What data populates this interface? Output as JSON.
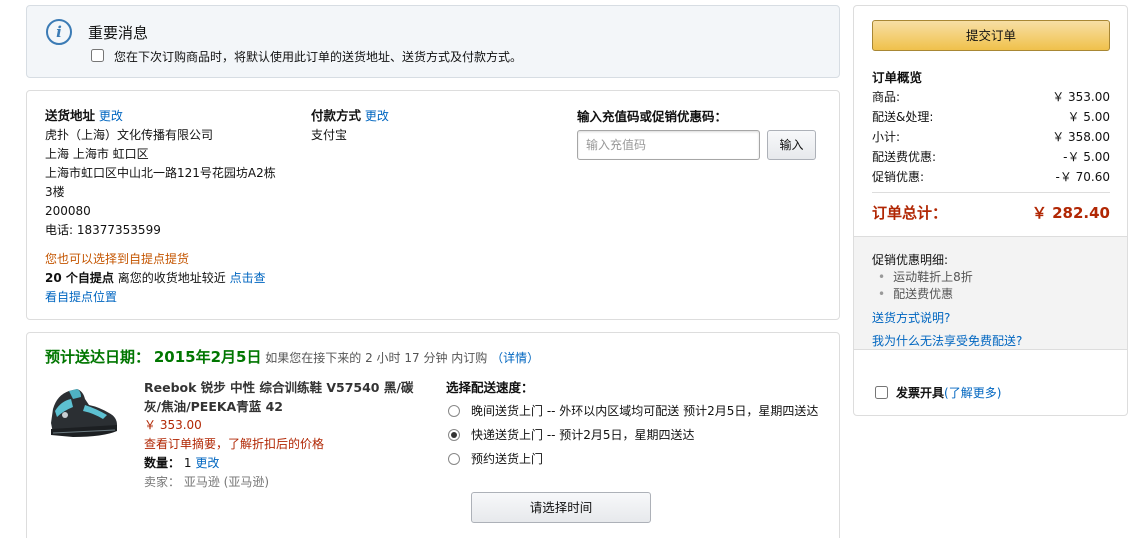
{
  "notice": {
    "title": "重要消息",
    "checkbox_text": "您在下次订购商品时，将默认使用此订单的送货地址、送货方式及付款方式。"
  },
  "shipping": {
    "label": "送货地址",
    "change": "更改",
    "lines": [
      "虎扑（上海）文化传播有限公司",
      "上海 上海市 虹口区",
      "上海市虹口区中山北一路121号花园坊A2栋",
      "3楼",
      "200080",
      "电话: 18377353599"
    ]
  },
  "payment": {
    "label": "付款方式",
    "change": "更改",
    "method": "支付宝"
  },
  "promo": {
    "label": "输入充值码或促销优惠码：",
    "placeholder": "输入充值码",
    "button": "输入"
  },
  "pickup": {
    "hint": "您也可以选择到自提点提货",
    "count": "20 个自提点",
    "near_text": "离您的收货地址较近",
    "view_link": "点击查",
    "location_link": "看自提点位置"
  },
  "delivery": {
    "label": "预计送达日期：",
    "date": "2015年2月5日",
    "condition": "如果您在接下来的 2 小时 17 分钟 内订购",
    "details_link": "（详情）"
  },
  "item": {
    "image": "sneaker-image",
    "title": "Reebok 锐步 中性 综合训练鞋 V57540 黑/碳灰/焦油/PEEKA青蓝 42",
    "price": "￥ 353.00",
    "note": "查看订单摘要，了解折扣后的价格",
    "qty_label": "数量：",
    "qty": "1",
    "qty_change": "更改",
    "seller_label": "卖家：",
    "seller": "亚马逊 (亚马逊)"
  },
  "speed": {
    "label": "选择配送速度：",
    "options": [
      {
        "text": "晚间送货上门 -- 外环以内区域均可配送 预计2月5日，星期四送达",
        "selected": false
      },
      {
        "text": "快递送货上门 --   预计2月5日，星期四送达",
        "selected": true
      },
      {
        "text": "预约送货上门",
        "selected": false
      }
    ],
    "time_button": "请选择时间"
  },
  "summary": {
    "submit": "提交订单",
    "title": "订单概览",
    "rows": [
      {
        "label": "商品:",
        "value": "￥ 353.00"
      },
      {
        "label": "配送&处理:",
        "value": "￥ 5.00"
      },
      {
        "label": "小计:",
        "value": "￥ 358.00"
      },
      {
        "label": "配送费优惠:",
        "value": "-￥ 5.00"
      },
      {
        "label": "促销优惠:",
        "value": "-￥ 70.60"
      }
    ],
    "total_label": "订单总计：",
    "total_value": "￥ 282.40",
    "promo_title": "促销优惠明细:",
    "promo_items": [
      "运动鞋折上8折",
      "配送费优惠"
    ],
    "link_shipping": "送货方式说明?",
    "link_free": "我为什么无法享受免费配送?",
    "invoice_label": "发票开具",
    "invoice_link": "(了解更多)"
  },
  "colors": {
    "accent_link": "#0066c0",
    "price_red": "#b12704",
    "delivery_green": "#007600",
    "submit_yellow": "#f0c14b"
  }
}
